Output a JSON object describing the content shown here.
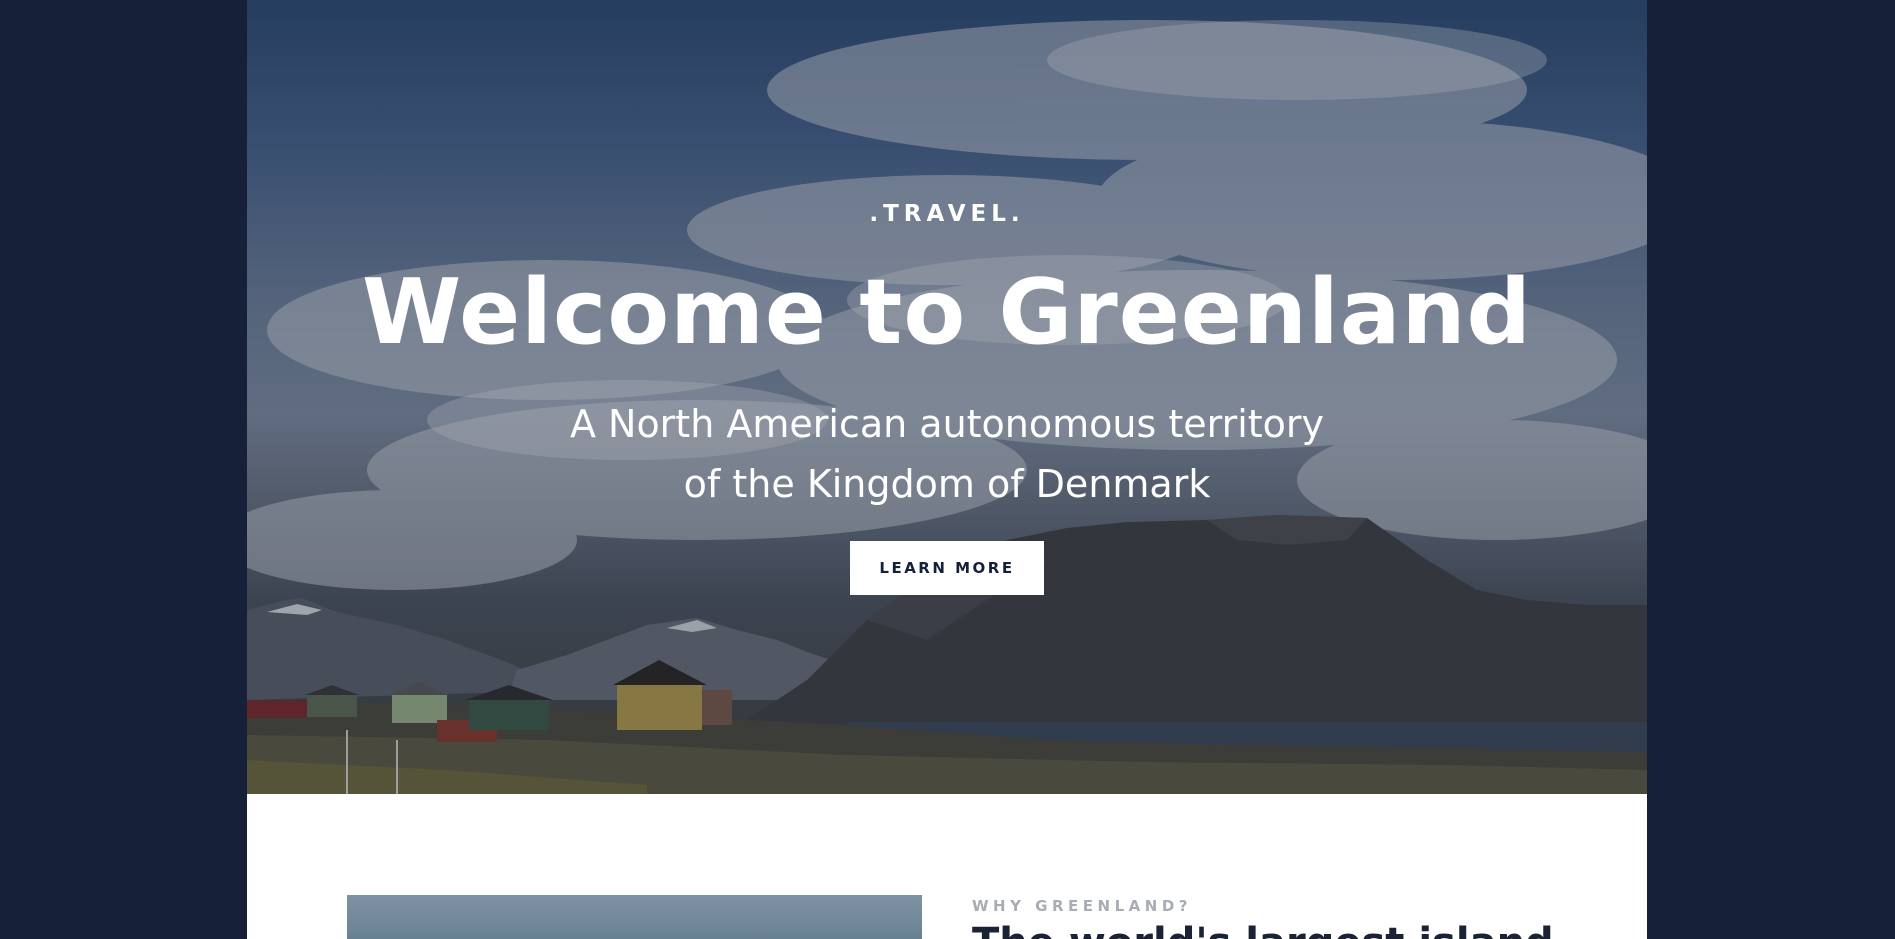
{
  "hero": {
    "eyebrow": ".TRAVEL.",
    "title": "Welcome to Greenland",
    "subtitle_line1": "A North American autonomous territory",
    "subtitle_line2": "of the Kingdom of Denmark",
    "cta_label": "LEARN MORE"
  },
  "intro": {
    "label": "WHY GREENLAND?",
    "heading": "The world's largest island"
  },
  "colors": {
    "background": "#162038",
    "cta_text": "#162038",
    "heading": "#1b2234",
    "label": "#a8acb4"
  }
}
